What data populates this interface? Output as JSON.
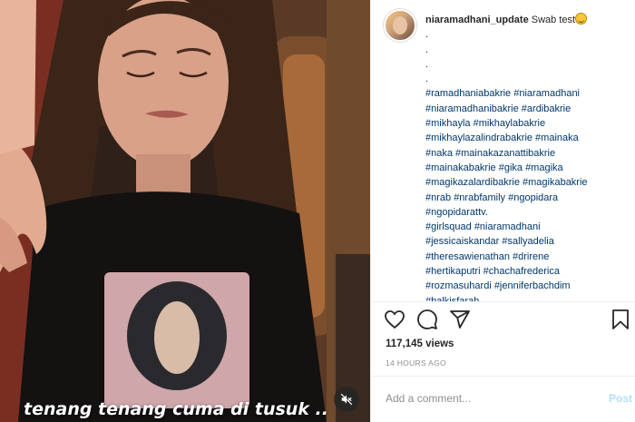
{
  "post": {
    "username": "niaramadhani_update",
    "caption": "Swab test",
    "caption_emoji": "grimacing-face",
    "dots": [
      ".",
      ".",
      ".",
      "."
    ],
    "hashtags": [
      "#ramadhaniabakrie #niaramadhani",
      "#niaramadhanibakrie #ardibakrie",
      "#mikhayla #mikhaylabakrie",
      "#mikhaylazalindrabakrie #mainaka",
      "#naka #mainakazanattibakrie",
      "#mainakabakrie #gika #magika",
      "#magikazalardibakrie #magikabakrie",
      "#nrab #nrabfamily #ngopidara",
      "#ngopidarattv.",
      "#girlsquad #niaramadhani",
      "#jessicaiskandar #sallyadelia",
      "#theresawienathan #drirene",
      "#hertikaputri #chachafrederica",
      "#rozmasuhardi #jenniferbachdim",
      "#balkisfarah"
    ],
    "views": "117,145 views",
    "timestamp": "14 HOURS AGO"
  },
  "video": {
    "caption_overlay": "tenang tenang cuma di tusuk .."
  },
  "comment": {
    "placeholder": "Add a comment...",
    "post_label": "Post"
  },
  "colors": {
    "hashtag": "#00376b",
    "post_disabled": "#b2dffc",
    "muted_text": "#8e8e8e"
  }
}
